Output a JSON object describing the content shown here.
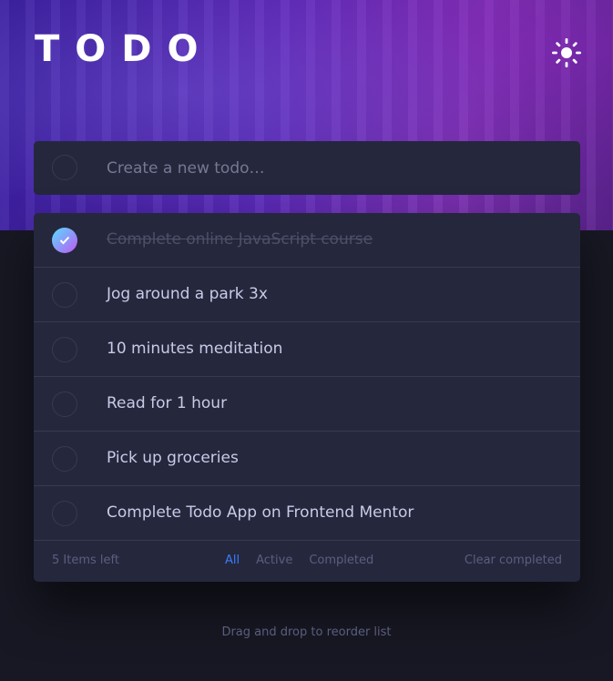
{
  "header": {
    "title": "TODO",
    "theme_icon": "sun-icon"
  },
  "new_todo": {
    "placeholder": "Create a new todo…"
  },
  "todos": [
    {
      "text": "Complete online JavaScript course",
      "completed": true
    },
    {
      "text": "Jog around a park 3x",
      "completed": false
    },
    {
      "text": "10 minutes meditation",
      "completed": false
    },
    {
      "text": "Read for 1 hour",
      "completed": false
    },
    {
      "text": "Pick up groceries",
      "completed": false
    },
    {
      "text": "Complete Todo App on Frontend Mentor",
      "completed": false
    }
  ],
  "footer": {
    "items_left": "5 Items left",
    "filters": [
      "All",
      "Active",
      "Completed"
    ],
    "active_filter": "All",
    "clear_label": "Clear completed"
  },
  "hint": "Drag and drop to reorder list",
  "colors": {
    "accent": "#3a7cfd",
    "check_gradient_start": "#55ddff",
    "check_gradient_end": "#c058f3",
    "card_bg": "#25273d",
    "page_bg": "#171823"
  }
}
